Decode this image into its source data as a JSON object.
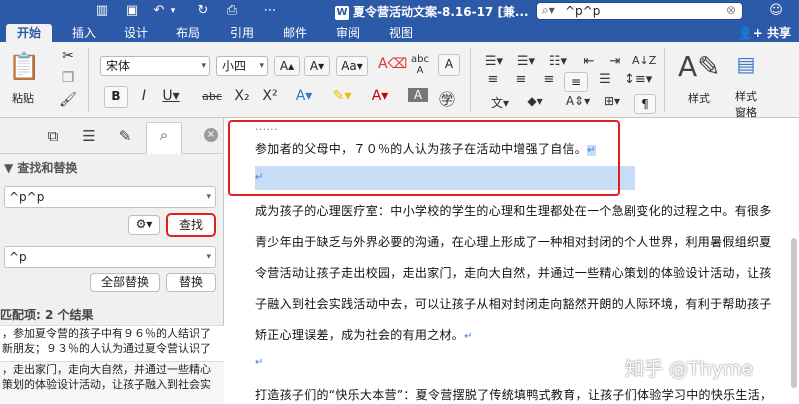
{
  "titlebar": {
    "doc_title": "夏令营活动文案-8.16-17 [兼...",
    "doc_badge": "W",
    "search_value": "^p^p",
    "icons": [
      "sidebar-icon",
      "save-icon",
      "undo-icon",
      "redo-icon",
      "print-icon",
      "customize-icon",
      "search-icon",
      "clear-icon",
      "user-icon"
    ]
  },
  "tabs": [
    "开始",
    "插入",
    "设计",
    "布局",
    "引用",
    "邮件",
    "审阅",
    "视图"
  ],
  "share_label": "共享",
  "ribbon": {
    "paste_label": "粘贴",
    "font_name": "宋体",
    "font_size": "小四",
    "style_label": "样式",
    "style_pane_label_1": "样式",
    "style_pane_label_2": "窗格"
  },
  "pane": {
    "section_title": "查找和替换",
    "find_value": "^p^p",
    "find_button": "查找",
    "replace_value": "^p",
    "replace_all_button": "全部替换",
    "replace_button": "替换",
    "results_header": "匹配项: 2 个结果",
    "results": [
      "，参加夏令营的孩子中有９６％的人结识了",
      "新朋友；９３％的人认为通过夏令营认识了",
      "，走出家门，走向大自然，并通过一些精心",
      "策划的体验设计活动，让孩子融入到社会实"
    ]
  },
  "document": {
    "line0": "参加者的父母中，７０％的人认为孩子在活动中增强了自信。",
    "line1": "成为孩子的心理医疗室：中小学校的学生的心理和生理都处在一个急剧变化的过程之中。有很多",
    "line2": "青少年由于缺乏与外界必要的沟通，在心理上形成了一种相对封闭的个人世界，利用暑假组织夏",
    "line3": "令营活动让孩子走出校园，走出家门，走向大自然，并通过一些精心策划的体验设计活动，让孩",
    "line4": "子融入到社会实践活动中去，可以让孩子从相对封闭走向豁然开朗的人际环境，有利于帮助孩子",
    "line5": "矫正心理误差，成为社会的有用之材。",
    "line6": "打造孩子们的“快乐大本营”：夏令营摆脱了传统填鸭式教育，让孩子们体验学习中的快乐生活，",
    "paragraph_mark": "↵"
  },
  "watermark": "知乎 @Thyme"
}
